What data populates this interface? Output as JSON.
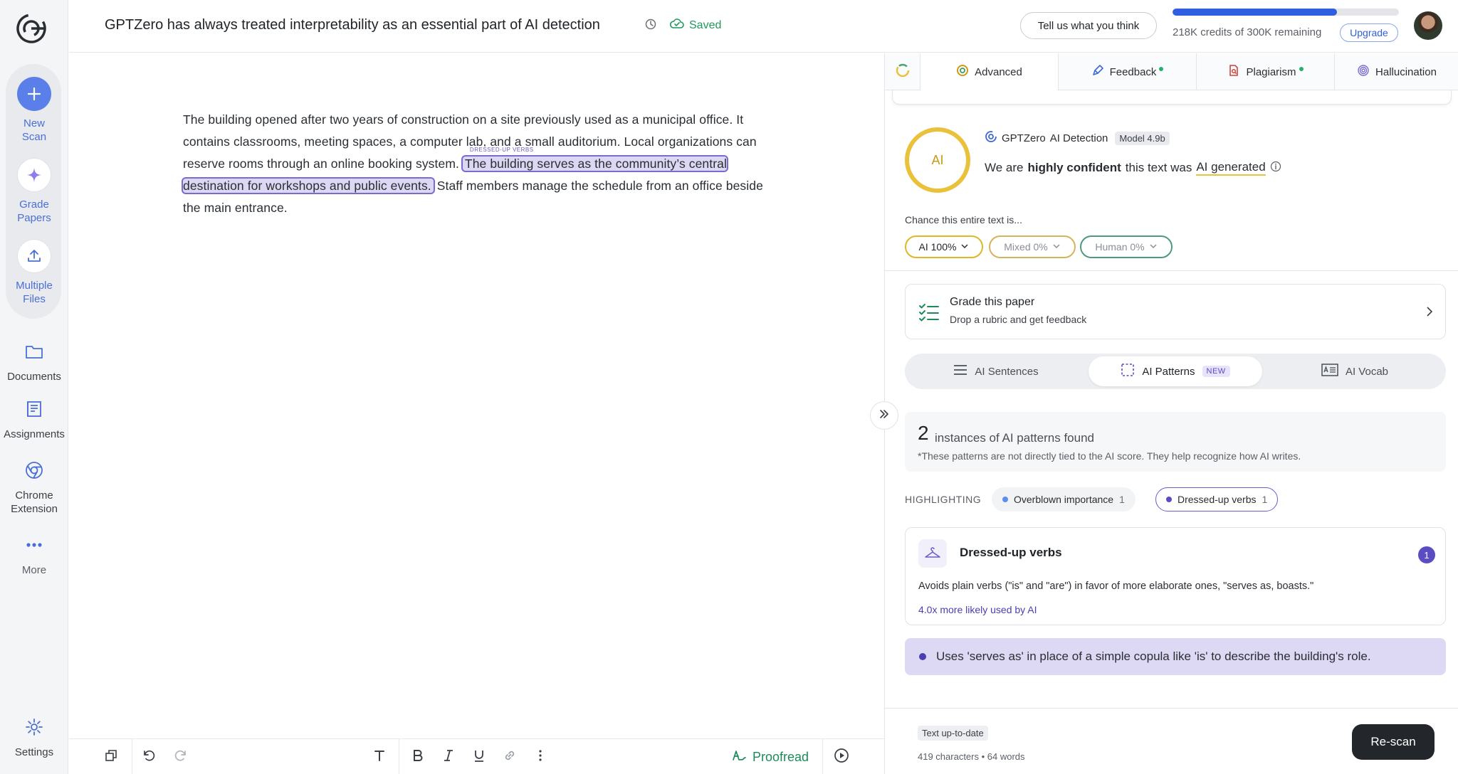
{
  "app": {
    "name": "GPTZero"
  },
  "sidebar": {
    "new_scan": "New\nScan",
    "grade_papers": "Grade\nPapers",
    "multiple_files": "Multiple\nFiles",
    "documents": "Documents",
    "assignments": "Assignments",
    "chrome_extension": "Chrome\nExtension",
    "more": "More",
    "settings": "Settings"
  },
  "header": {
    "doc_title": "GPTZero has always treated interpretability as an essential part of AI detection",
    "saved_label": "Saved",
    "feedback_button": "Tell us what you think",
    "credits_text": "218K credits of 300K remaining",
    "credits_fraction": 0.727,
    "upgrade_button": "Upgrade"
  },
  "editor": {
    "text_before": "The building opened after two years of construction on a site previously used as a municipal office. It contains classrooms, meeting spaces, a computer lab, and a small auditorium. Local organizations can reserve rooms through an online booking system. ",
    "highlight_tag": "DRESSED-UP VERBS",
    "highlight_text": "The building serves as the community’s central destination for workshops and public events.",
    "text_after": " Staff members manage the schedule from an office beside the main entrance."
  },
  "toolbar": {
    "proofread_label": "Proofread"
  },
  "panel": {
    "tabs": [
      {
        "label": "Advanced",
        "active": true,
        "dot": false
      },
      {
        "label": "Feedback",
        "active": false,
        "dot": true
      },
      {
        "label": "Plagiarism",
        "active": false,
        "dot": true
      },
      {
        "label": "Hallucination",
        "active": false,
        "dot": false
      }
    ],
    "score_ring_label": "AI",
    "detection_title": "GPTZero",
    "detection_suffix": "AI Detection",
    "model_badge": "Model 4.9b",
    "confidence_prefix": "We are",
    "confidence_strong": "highly confident",
    "confidence_mid": "this text was",
    "confidence_result": "AI generated",
    "chance_label": "Chance this entire text is...",
    "chips": [
      {
        "label": "AI 100%",
        "color": "#e0b52a"
      },
      {
        "label": "Mixed 0%",
        "color": "#d4b45a"
      },
      {
        "label": "Human 0%",
        "color": "#4e9a7c"
      }
    ],
    "grade_card": {
      "title": "Grade this paper",
      "subtitle": "Drop a rubric and get feedback"
    },
    "segments": [
      {
        "label": "AI Sentences",
        "active": false
      },
      {
        "label": "AI Patterns",
        "active": true,
        "badge": "NEW"
      },
      {
        "label": "AI Vocab",
        "active": false
      }
    ],
    "instances": {
      "count": "2",
      "label": "instances of AI patterns found",
      "note": "*These patterns are not directly tied to the AI score. They help recognize how AI writes."
    },
    "highlighting_label": "HIGHLIGHTING",
    "filters": [
      {
        "label": "Overblown importance",
        "count": "1",
        "color": "#5b8ef0",
        "selected": false
      },
      {
        "label": "Dressed-up verbs",
        "count": "1",
        "color": "#5b4cc4",
        "selected": true
      }
    ],
    "pattern": {
      "title": "Dressed-up verbs",
      "count": "1",
      "description": "Avoids plain verbs (\"is\" and \"are\") in favor of more elaborate ones, \"serves as, boasts.\"",
      "likelihood": "4.0x more likely used by AI"
    },
    "explanation": "Uses 'serves as' in place of a simple copula like 'is' to describe the building's role.",
    "footer": {
      "status": "Text up-to-date",
      "counts": "419 characters • 64 words",
      "rescan_button": "Re-scan"
    }
  }
}
